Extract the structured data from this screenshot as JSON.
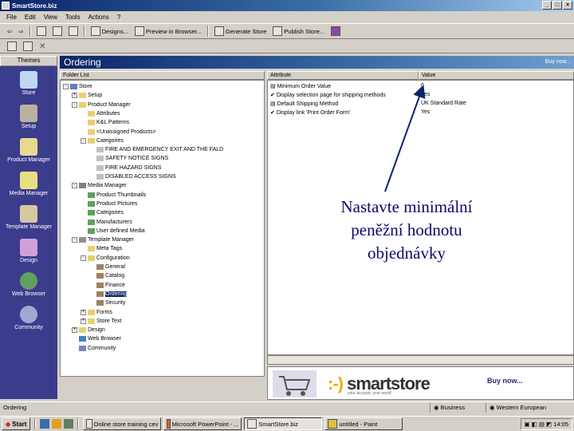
{
  "window": {
    "title": "SmartStore.biz",
    "controls": [
      "_",
      "□",
      "×"
    ]
  },
  "menu": [
    "File",
    "Edit",
    "View",
    "Tools",
    "Actions",
    "?"
  ],
  "toolbar": {
    "buttons": [
      "Designs...",
      "Preview in Browser...",
      "Generate Store",
      "Publish Store..."
    ]
  },
  "themes": {
    "header": "Themes",
    "items": [
      "Store",
      "Setup",
      "Product Manager",
      "Media Manager",
      "Template Manager",
      "Design",
      "Web Browser",
      "Community"
    ]
  },
  "main": {
    "title": "Ordering",
    "header_right": "Buy now...",
    "folder_list_header": "Folder List"
  },
  "tree": [
    {
      "label": "Store"
    },
    {
      "label": "Setup"
    },
    {
      "label": "Product Manager"
    },
    {
      "label": "Attributes"
    },
    {
      "label": "K&L Patterns"
    },
    {
      "label": "<Unassigned Products>"
    },
    {
      "label": "Categories"
    },
    {
      "label": "FIRE AND EMERGENCY EXIT AND THE FALD"
    },
    {
      "label": "SAFETY NOTICE SIGNS"
    },
    {
      "label": "FIRE HAZARD SIGNS"
    },
    {
      "label": "DISABLED ACCESS SIGNS"
    },
    {
      "label": "Media Manager"
    },
    {
      "label": "Product Thumbnails"
    },
    {
      "label": "Product Pictures"
    },
    {
      "label": "Categories"
    },
    {
      "label": "Manufacturers"
    },
    {
      "label": "User defined Media"
    },
    {
      "label": "Template Manager"
    },
    {
      "label": "Meta Tags"
    },
    {
      "label": "Configuration"
    },
    {
      "label": "General"
    },
    {
      "label": "Catalog"
    },
    {
      "label": "Finance"
    },
    {
      "label": "Ordering"
    },
    {
      "label": "Security"
    },
    {
      "label": "Forms"
    },
    {
      "label": "Store Text"
    },
    {
      "label": "Design"
    },
    {
      "label": "Web Browser"
    },
    {
      "label": "Community"
    }
  ],
  "attributes": {
    "header_attribute": "Attribute",
    "header_value": "Value",
    "rows": [
      {
        "attribute": "Minimum Order Value",
        "value": "0"
      },
      {
        "attribute": "Display selection page for shipping methods",
        "value": "Yes"
      },
      {
        "attribute": "Default Shipping Method",
        "value": "UK Standard Rate"
      },
      {
        "attribute": "Display link 'Print Order Form'",
        "value": "Yes"
      }
    ]
  },
  "banner": {
    "logo": "smartstore",
    "tagline": "your account. your world",
    "buy": "Buy now..."
  },
  "statusbar": {
    "left": "Ordering",
    "mode": "Business",
    "region": "Western European"
  },
  "taskbar": {
    "start": "Start",
    "tasks": [
      "Online store training cev",
      "Microsoft PowerPoint - ...",
      "SmartStore.biz",
      "untitled - Paint"
    ],
    "clock": "14:05"
  },
  "annotation": {
    "lines": [
      "Nastavte minimální",
      "peněžní hodnotu",
      "objednávky"
    ]
  },
  "colors": {
    "title_blue": "#0a246a",
    "theme_pane": "#3c3c8c",
    "annotation": "#0a0a6e"
  }
}
